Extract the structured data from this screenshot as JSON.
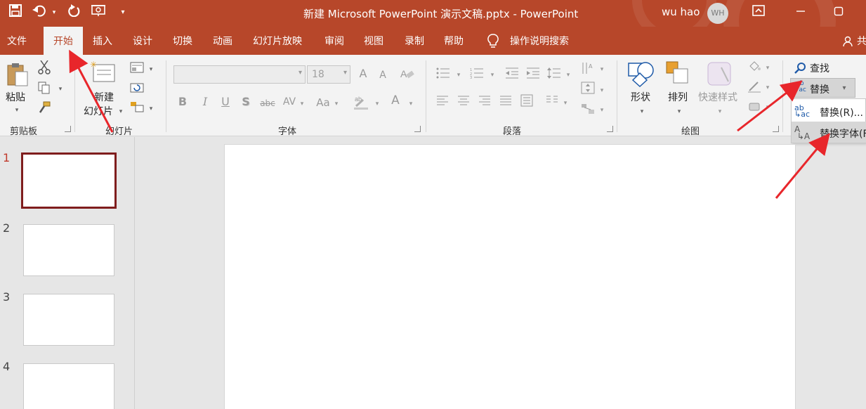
{
  "title_bar": {
    "doc_title": "新建 Microsoft PowerPoint 演示文稿.pptx  -  PowerPoint",
    "user_name": "wu hao",
    "avatar_initials": "WH",
    "accent_color": "#b7472a",
    "icons": [
      "save-icon",
      "undo-icon",
      "redo-icon",
      "present-icon",
      "customize-qat-icon",
      "ribbon-display-icon",
      "minimize-icon",
      "restore-icon"
    ]
  },
  "tabs": {
    "file": "文件",
    "home": "开始",
    "insert": "插入",
    "design": "设计",
    "transitions": "切换",
    "animations": "动画",
    "slideshow": "幻灯片放映",
    "review": "审阅",
    "view": "视图",
    "record": "录制",
    "help": "帮助",
    "tellme": "操作说明搜索",
    "share": "共"
  },
  "clipboard": {
    "paste": "粘贴",
    "group_label": "剪贴板"
  },
  "slides_group": {
    "new_slide_line1": "新建",
    "new_slide_line2": "幻灯片",
    "group_label": "幻灯片"
  },
  "font_group": {
    "font_size": "18",
    "bold": "B",
    "italic": "I",
    "underline": "U",
    "shadow": "S",
    "strike": "abc",
    "spacing": "AV",
    "case": "Aa",
    "color": "A",
    "grow": "A",
    "shrink": "A",
    "group_label": "字体"
  },
  "paragraph_group": {
    "group_label": "段落"
  },
  "drawing_group": {
    "shapes": "形状",
    "arrange": "排列",
    "quick_styles": "快速样式",
    "group_label": "绘图"
  },
  "editing_group": {
    "find": "查找",
    "replace": "替换"
  },
  "replace_menu": {
    "replace_item": "替换(R)...",
    "replace_font_item": "替换字体(F)"
  },
  "slide_numbers": [
    "1",
    "2",
    "3",
    "4"
  ],
  "selected_slide_color": "#7f1d1d",
  "annotation_arrow_color": "#e8262b"
}
